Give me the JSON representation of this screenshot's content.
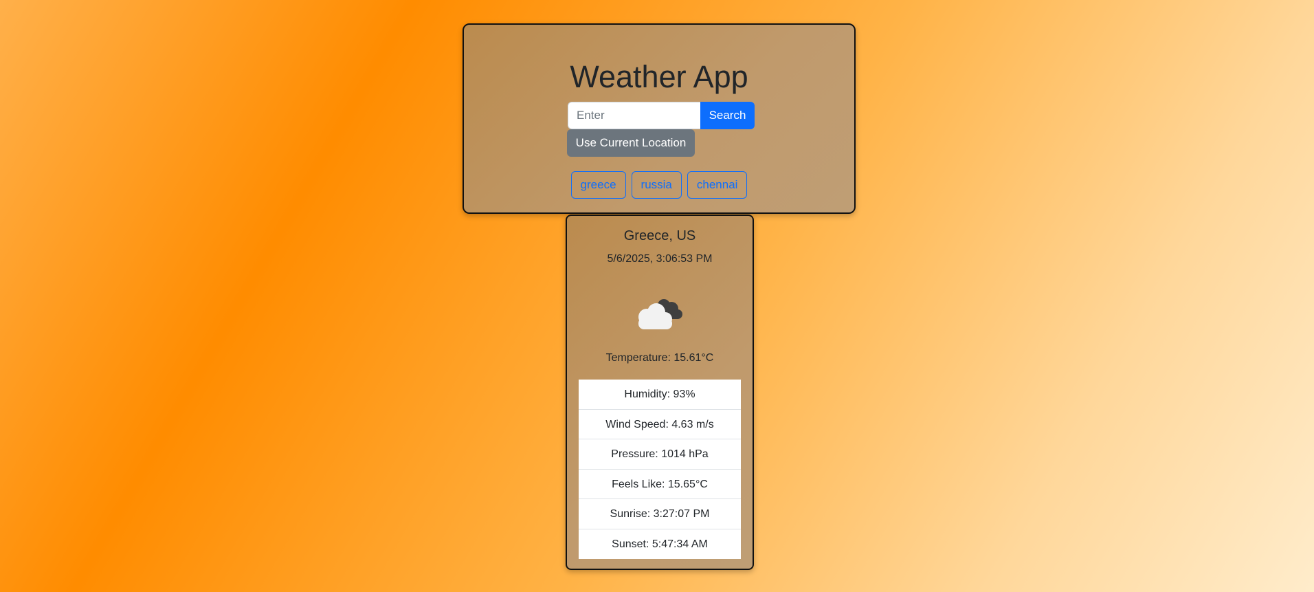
{
  "app": {
    "title": "Weather App"
  },
  "search": {
    "placeholder": "Enter",
    "value": "",
    "button_label": "Search",
    "location_button_label": "Use Current Location"
  },
  "recent_searches": [
    {
      "label": "greece"
    },
    {
      "label": "russia"
    },
    {
      "label": "chennai"
    }
  ],
  "weather": {
    "location": "Greece, US",
    "datetime": "5/6/2025, 3:06:53 PM",
    "icon": "cloudy-icon",
    "temperature": "Temperature: 15.61°C",
    "details": [
      {
        "text": "Humidity: 93%"
      },
      {
        "text": "Wind Speed: 4.63 m/s"
      },
      {
        "text": "Pressure: 1014 hPa"
      },
      {
        "text": "Feels Like: 15.65°C"
      },
      {
        "text": "Sunrise: 3:27:07 PM"
      },
      {
        "text": "Sunset: 5:47:34 AM"
      }
    ]
  },
  "colors": {
    "primary": "#0d6efd",
    "secondary": "#6c757d",
    "panel": "#c09a6c",
    "background_accent": "#ff8c00"
  }
}
